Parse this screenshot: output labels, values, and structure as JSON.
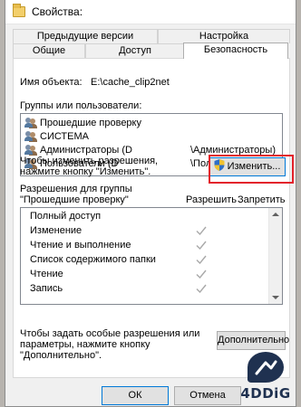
{
  "window": {
    "title": "Свойства:"
  },
  "tabs": {
    "row1": [
      {
        "label": "Предыдущие версии"
      },
      {
        "label": "Настройка"
      }
    ],
    "row2": [
      {
        "label": "Общие"
      },
      {
        "label": "Доступ"
      },
      {
        "label": "Безопасность",
        "active": true
      }
    ]
  },
  "object": {
    "label": "Имя объекта:",
    "value": "E:\\cache_clip2net"
  },
  "groups": {
    "label": "Группы или пользователи:",
    "items": [
      {
        "name": "Прошедшие проверку",
        "domain": "",
        "selected": true
      },
      {
        "name": "СИСТЕМА",
        "domain": ""
      },
      {
        "name": "Администраторы (D",
        "domain": "\\Администраторы)"
      },
      {
        "name": "Пользователи (D",
        "domain": "\\Пользователи)"
      }
    ]
  },
  "change": {
    "hint_line1": "Чтобы изменить разрешения,",
    "hint_line2": "нажмите кнопку \"Изменить\".",
    "button_label": "Изменить..."
  },
  "permissions": {
    "title_line1": "Разрешения для группы",
    "title_line2": "\"Прошедшие проверку\"",
    "allow_header": "Разрешить",
    "deny_header": "Запретить",
    "rows": [
      {
        "name": "Полный доступ",
        "allow": false
      },
      {
        "name": "Изменение",
        "allow": true
      },
      {
        "name": "Чтение и выполнение",
        "allow": true
      },
      {
        "name": "Список содержимого папки",
        "allow": true
      },
      {
        "name": "Чтение",
        "allow": true
      },
      {
        "name": "Запись",
        "allow": true
      }
    ]
  },
  "advanced": {
    "hint_line1": "Чтобы задать особые разрешения или",
    "hint_line2": "параметры, нажмите кнопку",
    "hint_line3": "\"Дополнительно\".",
    "button_label": "Дополнительно"
  },
  "footer": {
    "ok_label": "ОК",
    "cancel_label": "Отмена"
  },
  "brand": {
    "name": "4DDiG"
  },
  "colors": {
    "highlight_frame": "#e3222b",
    "check_gray": "#a8a8a8",
    "brand": "#1f3150"
  }
}
